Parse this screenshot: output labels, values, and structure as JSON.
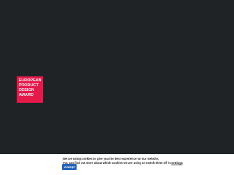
{
  "award_logo": {
    "lines": [
      "EUROPEAN",
      "PRODUCT",
      "DESIGN",
      "AWARD"
    ],
    "color": "#e5194a"
  },
  "cookie_banner": {
    "line1": "We are using cookies to give you the best experience on our website.",
    "line2_prefix": "You can find out more about which cookies we are using or switch them off in ",
    "settings_link": "settings",
    "line2_suffix": ".",
    "accept_label": "Accept",
    "accept_color": "#2563b8"
  },
  "colors": {
    "background": "#1f2326"
  }
}
